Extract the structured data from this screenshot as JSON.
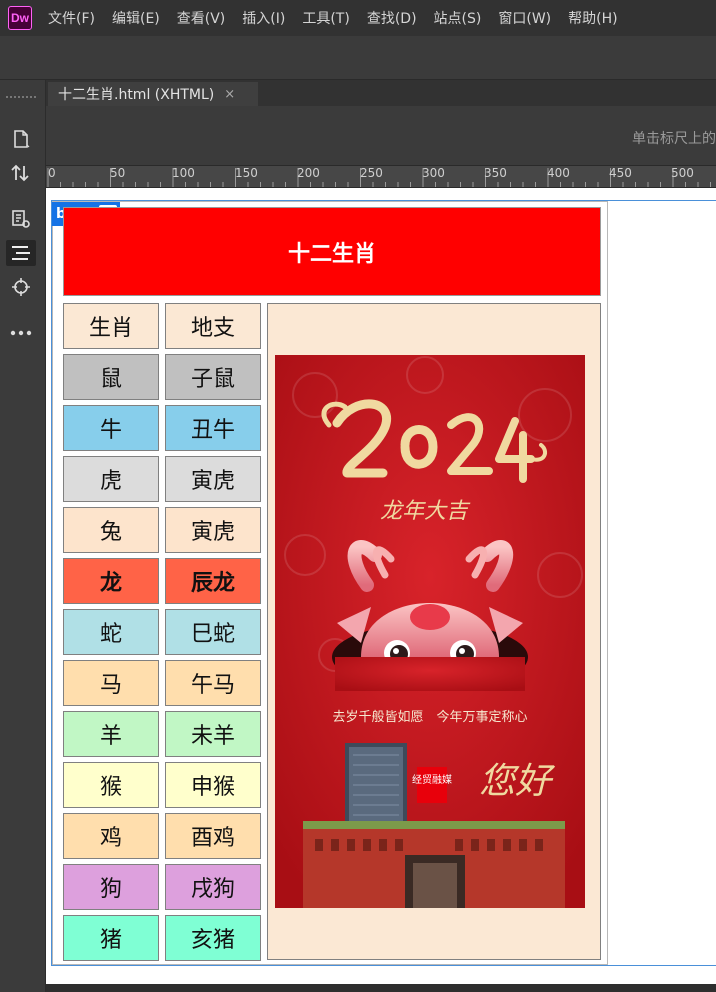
{
  "app": {
    "logo": "Dw"
  },
  "menu": [
    "文件(F)",
    "编辑(E)",
    "查看(V)",
    "插入(I)",
    "工具(T)",
    "查找(D)",
    "站点(S)",
    "窗口(W)",
    "帮助(H)"
  ],
  "tab": {
    "title": "十二生肖.html (XHTML)",
    "close": "×"
  },
  "hint": "单击标尺上的",
  "ruler": [
    "0",
    "50",
    "100",
    "150",
    "200",
    "250",
    "300",
    "350",
    "400",
    "450",
    "500"
  ],
  "body_tag": {
    "label": "body",
    "plus": "+"
  },
  "page": {
    "title": "十二生肖",
    "header_row": {
      "animal": "生肖",
      "branch": "地支",
      "bg": "#fbe8d4"
    },
    "rows": [
      {
        "animal": "鼠",
        "branch": "子鼠",
        "bg": "#c0c0c0",
        "bold": false
      },
      {
        "animal": "牛",
        "branch": "丑牛",
        "bg": "#87ceeb",
        "bold": false
      },
      {
        "animal": "虎",
        "branch": "寅虎",
        "bg": "#dcdcdc",
        "bold": false
      },
      {
        "animal": "兔",
        "branch": "寅虎",
        "bg": "#fde4cc",
        "bold": false
      },
      {
        "animal": "龙",
        "branch": "辰龙",
        "bg": "#ff6347",
        "bold": true
      },
      {
        "animal": "蛇",
        "branch": "巳蛇",
        "bg": "#b0e0e6",
        "bold": false
      },
      {
        "animal": "马",
        "branch": "午马",
        "bg": "#ffdead",
        "bold": false
      },
      {
        "animal": "羊",
        "branch": "未羊",
        "bg": "#c1f7c5",
        "bold": false
      },
      {
        "animal": "猴",
        "branch": "申猴",
        "bg": "#ffffcc",
        "bold": false
      },
      {
        "animal": "鸡",
        "branch": "酉鸡",
        "bg": "#ffdead",
        "bold": false
      },
      {
        "animal": "狗",
        "branch": "戌狗",
        "bg": "#dda0dd",
        "bold": false
      },
      {
        "animal": "猪",
        "branch": "亥猪",
        "bg": "#7fffd4",
        "bold": false
      }
    ]
  },
  "poster": {
    "year": "2024",
    "greeting": "龙年大吉",
    "tagline": "去岁千般皆如愿　今年万事定称心",
    "seal": "经贸融媒",
    "brush_text": "您好",
    "colors": {
      "bg": "#c4141b",
      "gold": "#f0d9a0",
      "dragon": "#f29a9a"
    }
  },
  "colors": {
    "header_red": "#ff0000",
    "panel": "#fbe8d4",
    "selection_blue": "#1473e6"
  }
}
